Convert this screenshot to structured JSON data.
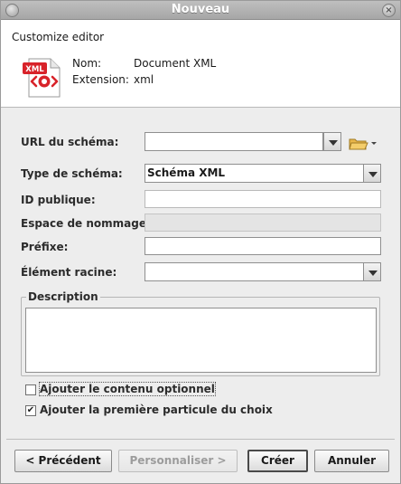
{
  "window": {
    "title": "Nouveau",
    "close_glyph": "×"
  },
  "header": {
    "subtitle": "Customize editor",
    "icon": {
      "name": "xml-file-icon",
      "badge": "XML"
    },
    "name_label": "Nom:",
    "name_value": "Document XML",
    "extension_label": "Extension:",
    "extension_value": "xml"
  },
  "form": {
    "schema_url": {
      "label": "URL du schéma:",
      "value": ""
    },
    "schema_type": {
      "label": "Type de schéma:",
      "value": "Schéma XML"
    },
    "public_id": {
      "label": "ID publique:",
      "value": ""
    },
    "namespace": {
      "label": "Espace de nommage:",
      "value": ""
    },
    "prefix": {
      "label": "Préfixe:",
      "value": ""
    },
    "root_element": {
      "label": "Élément racine:",
      "value": ""
    },
    "description": {
      "label": "Description",
      "value": ""
    }
  },
  "options": {
    "optional_content": {
      "label": "Ajouter le contenu optionnel",
      "checked": false
    },
    "first_choice": {
      "label": "Ajouter la première particule du choix",
      "checked": true,
      "check_glyph": "✔"
    }
  },
  "buttons": {
    "previous": "< Précédent",
    "customize": "Personnaliser >",
    "create": "Créer",
    "cancel": "Annuler"
  },
  "colors": {
    "icon_red": "#d8232a",
    "title_text": "#ffffff"
  }
}
